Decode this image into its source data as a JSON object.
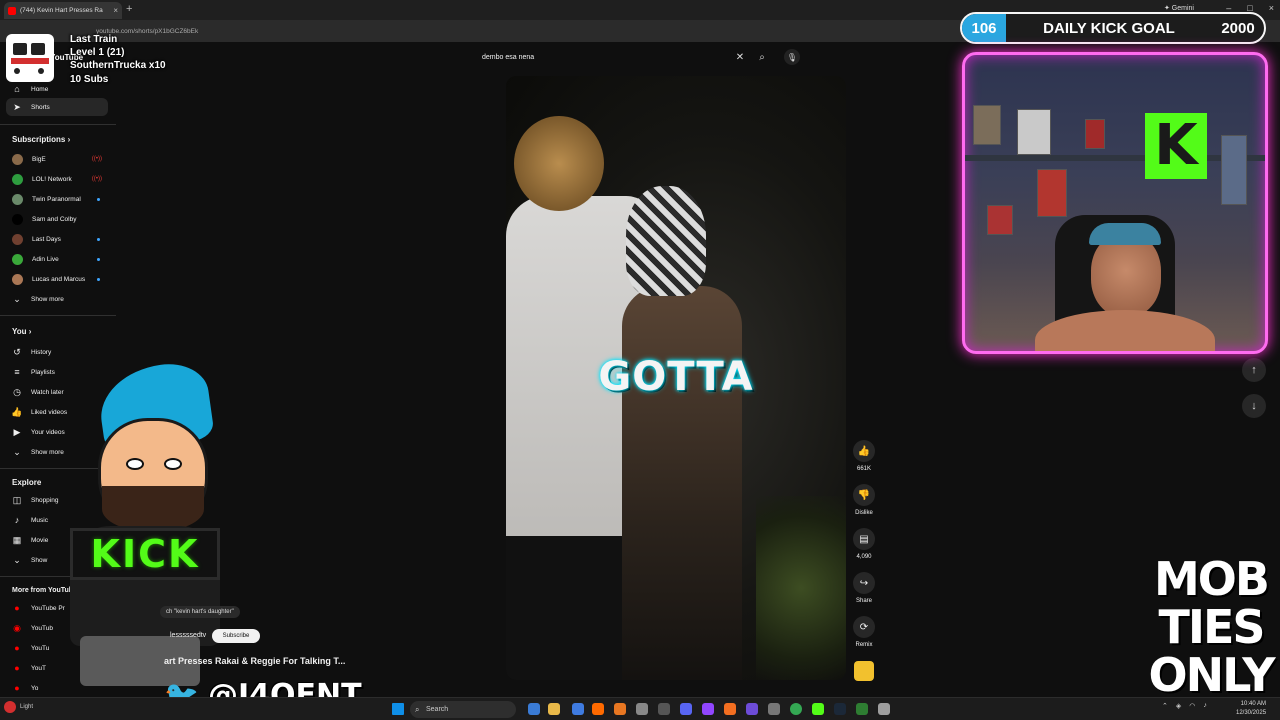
{
  "browser": {
    "tab_title": "(744) Kevin Hart Presses Ra",
    "tab_close": "×",
    "new_tab": "+",
    "gemini_label": "✦ Gemini",
    "window_min": "–",
    "window_max": "□",
    "window_close": "×",
    "url": "youtube.com/shorts/pX1bGCZ6bEk"
  },
  "overlay": {
    "train_name": "Last Train",
    "level": "Level 1  (21)",
    "trucka": "SouthernTrucka x10",
    "subs": "10 Subs",
    "yt_wordmark": "YouTube"
  },
  "sidebar": {
    "home": "Home",
    "shorts": "Shorts",
    "subscriptions_title": "Subscriptions",
    "subscriptions": [
      {
        "name": "BigE",
        "color": "#8a6a4a",
        "badge": "live"
      },
      {
        "name": "LOL! Network",
        "color": "#2e9d3f",
        "badge": "live"
      },
      {
        "name": "Twin Paranormal",
        "color": "#6a8a6a",
        "badge": "dot"
      },
      {
        "name": "Sam and Colby",
        "color": "#000000",
        "badge": "none"
      },
      {
        "name": "Last Days",
        "color": "#704030",
        "badge": "dot"
      },
      {
        "name": "Adin Live",
        "color": "#3aa83a",
        "badge": "dot"
      },
      {
        "name": "Lucas and Marcus",
        "color": "#aa7755",
        "badge": "dot"
      }
    ],
    "show_more_1": "Show more",
    "you_title": "You",
    "you_items": [
      "History",
      "Playlists",
      "Watch later",
      "Liked videos",
      "Your videos"
    ],
    "show_more_2": "Show more",
    "explore_title": "Explore",
    "explore_items": [
      "Shopping",
      "Music",
      "Movie",
      "Show"
    ],
    "more_title": "More from YouTub",
    "more_items": [
      "YouTube Pr",
      "YouTub",
      "YouTu",
      "YouT",
      "Yo"
    ]
  },
  "search": {
    "query": "dembo esa nena",
    "clear_icon": "clear-icon",
    "search_icon": "search-icon",
    "mic_icon": "mic-icon"
  },
  "video": {
    "caption": "GOTTA"
  },
  "actions": {
    "like_count": "661K",
    "dislike_label": "Dislike",
    "comments_count": "4,090",
    "share_label": "Share",
    "remix_label": "Remix"
  },
  "goal": {
    "current": "106",
    "title": "DAILY KICK GOAL",
    "target": "2000"
  },
  "lower": {
    "search_chip": "ch \"kevin hart's daughter\"",
    "channel": "lesssssedtv",
    "subscribe": "Subscribe",
    "short_title": "art Presses Rakai & Reggie For Talking T...",
    "handle": "@J4OENT"
  },
  "mascot": {
    "sign": "KICK"
  },
  "mob": [
    "MOB",
    "TIES",
    "ONLY"
  ],
  "taskbar": {
    "search": "Search",
    "time": "10:40 AM",
    "date": "12/30/2025",
    "weather": "Light"
  },
  "colors": {
    "kick_green": "#53fc18",
    "goal_blue": "#2aa7e0",
    "neon_pink": "#ff2fd4",
    "yt_red": "#ff0000"
  }
}
